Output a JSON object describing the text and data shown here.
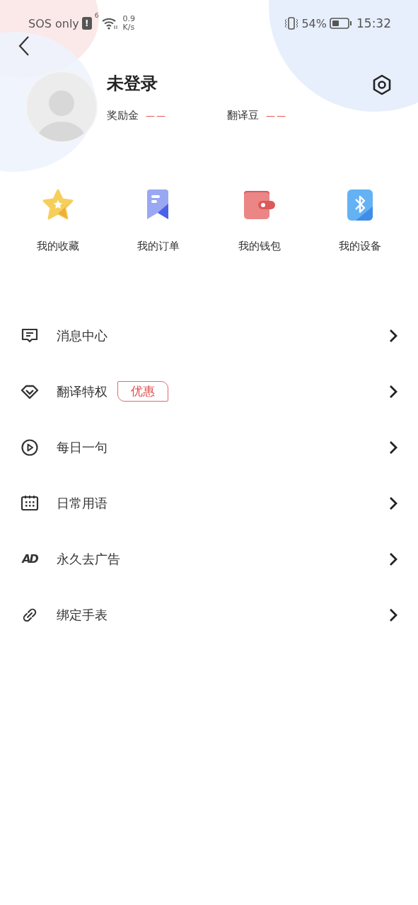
{
  "status_bar": {
    "carrier": "SOS only",
    "alert": "!",
    "network": "6",
    "speed_value": "0.9",
    "speed_unit": "K/s",
    "battery": "54%",
    "time": "15:32"
  },
  "profile": {
    "name": "未登录",
    "stats": [
      {
        "label": "奖励金",
        "value": "——"
      },
      {
        "label": "翻译豆",
        "value": "——"
      }
    ]
  },
  "shortcuts": [
    {
      "label": "我的收藏"
    },
    {
      "label": "我的订单"
    },
    {
      "label": "我的钱包"
    },
    {
      "label": "我的设备"
    }
  ],
  "menu": [
    {
      "label": "消息中心"
    },
    {
      "label": "翻译特权",
      "badge": "优惠"
    },
    {
      "label": "每日一句"
    },
    {
      "label": "日常用语"
    },
    {
      "label": "永久去广告",
      "icon_text": "AD"
    },
    {
      "label": "绑定手表"
    }
  ]
}
